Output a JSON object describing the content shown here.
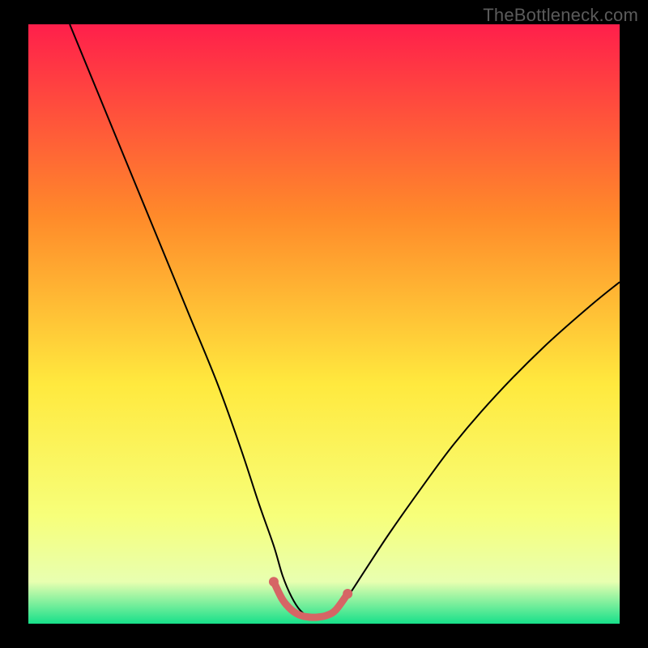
{
  "watermark": "TheBottleneck.com",
  "chart_data": {
    "type": "line",
    "title": "",
    "xlabel": "",
    "ylabel": "",
    "xlim": [
      0,
      100
    ],
    "ylim": [
      0,
      100
    ],
    "gradient_colors": {
      "top": "#ff1f4b",
      "mid1": "#ff8a2a",
      "mid2": "#ffe93e",
      "mid3": "#f7ff7a",
      "near_bottom": "#e8ffb0",
      "bottom": "#17e08a"
    },
    "series": [
      {
        "name": "bottleneck-curve",
        "color": "#000000",
        "width": 2,
        "x": [
          7,
          12,
          17,
          22,
          27,
          32,
          36,
          39,
          41.5,
          43,
          44.5,
          46,
          47.5,
          49,
          50.5,
          52,
          54,
          57,
          61,
          66,
          72,
          79,
          87,
          95,
          100
        ],
        "y": [
          100,
          88,
          76,
          64,
          52,
          40,
          29,
          20,
          13,
          8,
          4.5,
          2.2,
          1.2,
          1.0,
          1.2,
          2.2,
          4.5,
          9,
          15,
          22,
          30,
          38,
          46,
          53,
          57
        ]
      },
      {
        "name": "optimal-highlight",
        "color": "#d66565",
        "width": 9,
        "linecap": "round",
        "x": [
          41.5,
          43,
          44.5,
          46,
          47.5,
          49,
          50.5,
          52,
          54
        ],
        "y": [
          7.0,
          4.0,
          2.3,
          1.4,
          1.1,
          1.1,
          1.4,
          2.3,
          5.0
        ]
      }
    ],
    "highlight_dots": {
      "color": "#d66565",
      "radius": 6,
      "points": [
        {
          "x": 41.5,
          "y": 7.0
        },
        {
          "x": 54.0,
          "y": 5.0
        }
      ]
    }
  }
}
